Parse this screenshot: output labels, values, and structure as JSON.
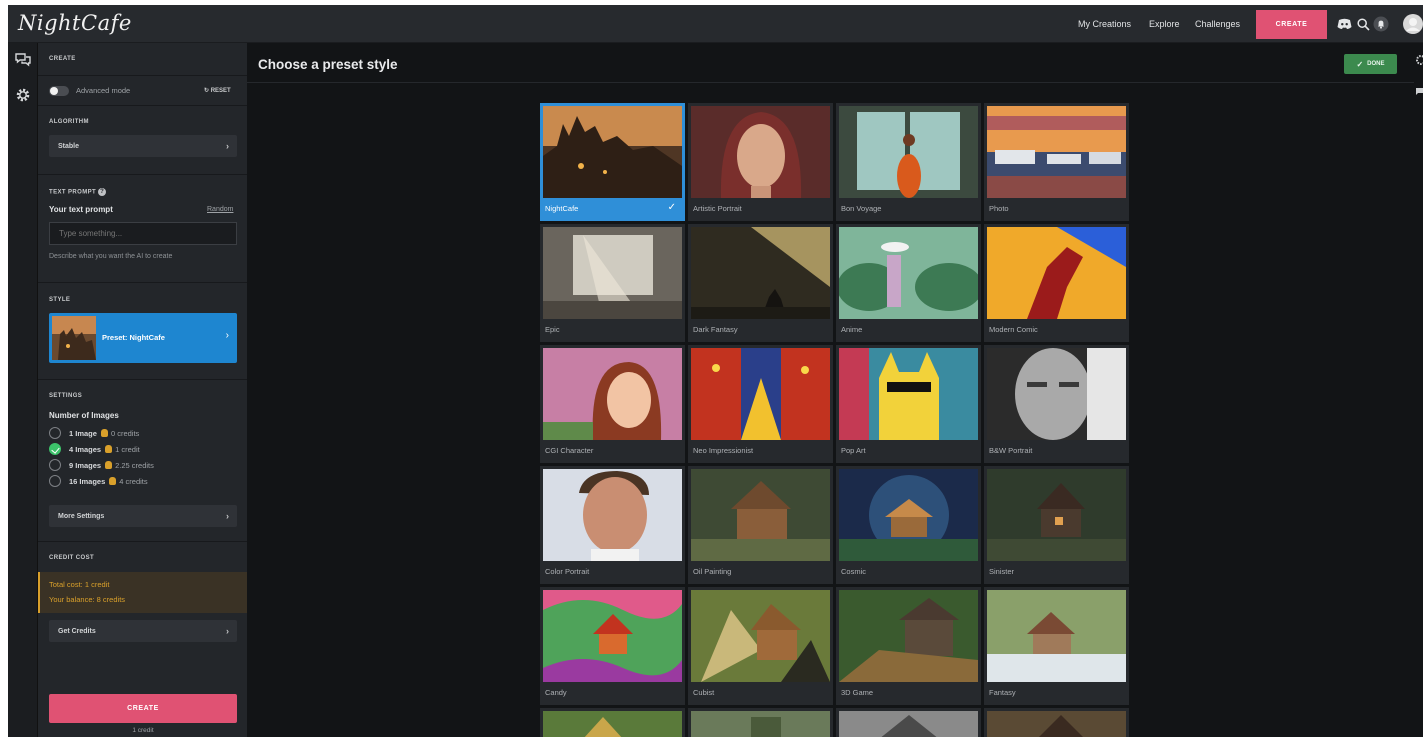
{
  "header": {
    "logo": "NightCafe",
    "nav": {
      "my_creations": "My Creations",
      "explore": "Explore",
      "challenges": "Challenges",
      "create": "CREATE"
    }
  },
  "sidebar": {
    "create_title": "CREATE",
    "advanced_mode_label": "Advanced mode",
    "reset_label": "RESET",
    "algorithm": {
      "title": "ALGORITHM",
      "value": "Stable"
    },
    "text_prompt": {
      "title": "TEXT PROMPT",
      "label": "Your text prompt",
      "random_link": "Random",
      "placeholder": "Type something...",
      "hint": "Describe what you want the AI to create"
    },
    "style": {
      "title": "STYLE",
      "preset_label": "Preset: NightCafe"
    },
    "settings": {
      "title": "SETTINGS",
      "num_images_label": "Number of Images",
      "options": [
        {
          "label": "1 Image",
          "credits": "0 credits",
          "selected": false
        },
        {
          "label": "4 Images",
          "credits": "1 credit",
          "selected": true
        },
        {
          "label": "9 Images",
          "credits": "2.25 credits",
          "selected": false
        },
        {
          "label": "16 Images",
          "credits": "4 credits",
          "selected": false
        }
      ],
      "more_settings": "More Settings"
    },
    "credit_cost": {
      "title": "CREDIT COST",
      "total": "Total cost: 1 credit",
      "balance": "Your balance: 8 credits",
      "get_credits": "Get Credits"
    },
    "create_button": "CREATE",
    "create_cost": "1 credit"
  },
  "content": {
    "title": "Choose a preset style",
    "done_label": "DONE",
    "presets": [
      {
        "label": "NightCafe",
        "selected": true
      },
      {
        "label": "Artistic Portrait"
      },
      {
        "label": "Bon Voyage"
      },
      {
        "label": "Photo"
      },
      {
        "label": "Epic"
      },
      {
        "label": "Dark Fantasy"
      },
      {
        "label": "Anime"
      },
      {
        "label": "Modern Comic"
      },
      {
        "label": "CGI Character"
      },
      {
        "label": "Neo Impressionist"
      },
      {
        "label": "Pop Art"
      },
      {
        "label": "B&W Portrait"
      },
      {
        "label": "Color Portrait"
      },
      {
        "label": "Oil Painting"
      },
      {
        "label": "Cosmic"
      },
      {
        "label": "Sinister"
      },
      {
        "label": "Candy"
      },
      {
        "label": "Cubist"
      },
      {
        "label": "3D Game"
      },
      {
        "label": "Fantasy"
      }
    ]
  },
  "icons": {
    "rail": [
      "chat-bubbles-icon",
      "settings-gear-icon"
    ],
    "top": [
      "discord-icon",
      "search-icon",
      "notifications-bell-icon",
      "avatar"
    ]
  },
  "colors": {
    "accent": "#e05273",
    "selected": "#2f8fd8",
    "done": "#3c8a4e",
    "success": "#3cc26a"
  }
}
